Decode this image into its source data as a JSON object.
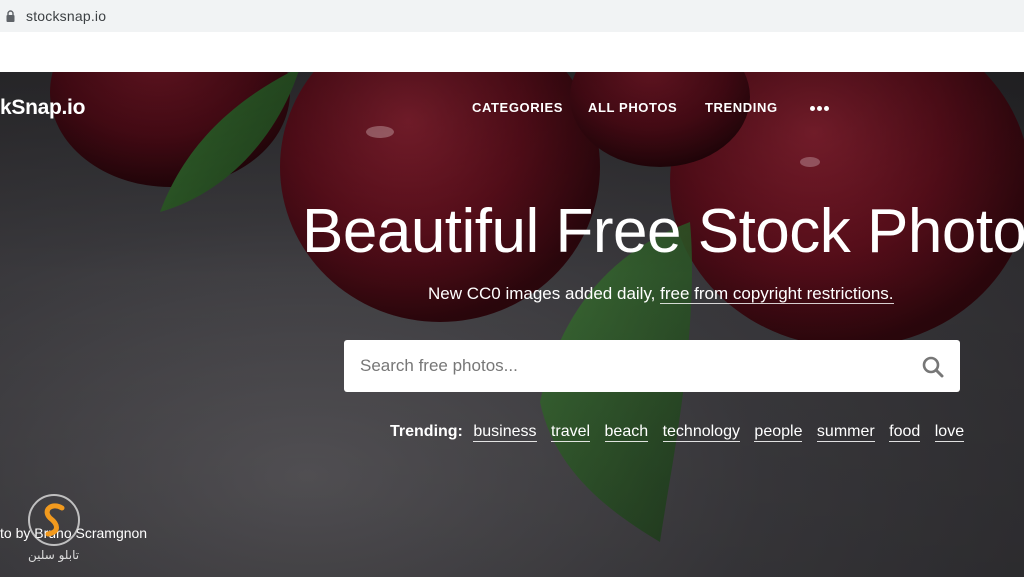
{
  "browser": {
    "url": "stocksnap.io",
    "lock_icon": "lock-icon"
  },
  "header": {
    "logo_text": "kSnap.io",
    "nav": {
      "categories": "CATEGORIES",
      "all_photos": "ALL PHOTOS",
      "trending": "TRENDING",
      "more_icon": "more-dots-icon"
    }
  },
  "hero": {
    "headline": "Beautiful Free Stock Photos",
    "subline_prefix": "New CC0 images added daily, ",
    "subline_link": "free from copyright restrictions.",
    "search": {
      "placeholder": "Search free photos...",
      "value": "",
      "icon": "search-icon"
    },
    "trending_label": "Trending:",
    "trending_tags": [
      "business",
      "travel",
      "beach",
      "technology",
      "people",
      "summer",
      "food",
      "love"
    ],
    "photo_credit": "to by Bruno Scramgnon"
  },
  "watermark": {
    "text": "تابلو سلین",
    "icon": "s-logo-icon"
  },
  "colors": {
    "plum": "#5e0f1c",
    "leaf": "#2f5a2a",
    "background": "#3d3c40",
    "text": "#ffffff"
  }
}
